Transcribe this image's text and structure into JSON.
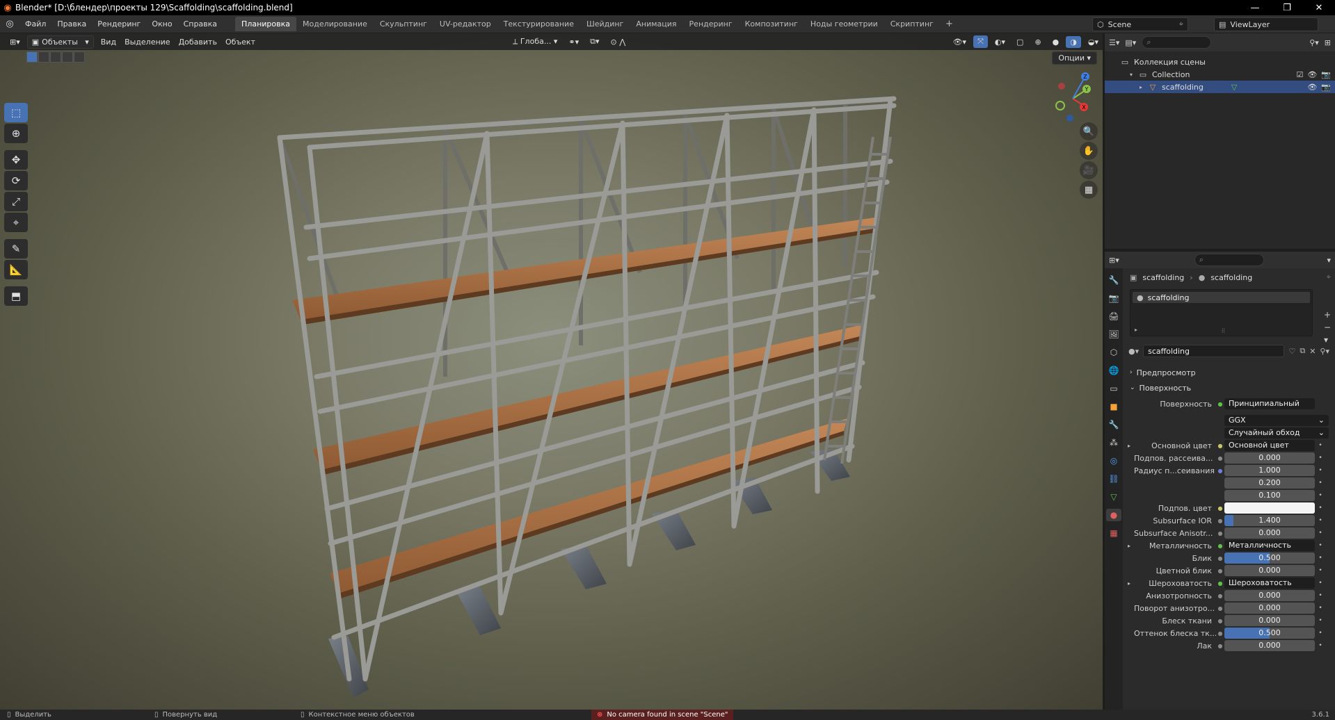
{
  "window": {
    "title": "Blender* [D:\\блендер\\проекты 129\\Scaffolding\\scaffolding.blend]",
    "controls": [
      "—",
      "❐",
      "✕"
    ]
  },
  "menu": [
    "Файл",
    "Правка",
    "Рендеринг",
    "Окно",
    "Справка"
  ],
  "workspaces": [
    "Планировка",
    "Моделирование",
    "Скульптинг",
    "UV-редактор",
    "Текстурирование",
    "Шейдинг",
    "Анимация",
    "Рендеринг",
    "Композитинг",
    "Ноды геометрии",
    "Скриптинг"
  ],
  "active_workspace": "Планировка",
  "scene": {
    "name": "Scene",
    "view_layer": "ViewLayer"
  },
  "viewport": {
    "mode": "Объекты",
    "menus": [
      "Вид",
      "Выделение",
      "Добавить",
      "Объект"
    ],
    "orientation": "Глоба...",
    "options_label": "Опции",
    "gizmo_axes": {
      "x": "X",
      "y": "Y",
      "z": "Z"
    }
  },
  "outliner": {
    "rows": [
      {
        "label": "Коллекция сцены",
        "icon": "scene-collection-icon"
      },
      {
        "label": "Collection",
        "icon": "collection-icon"
      },
      {
        "label": "scaffolding",
        "icon": "mesh-object-icon",
        "selected": true
      }
    ]
  },
  "properties": {
    "breadcrumb": [
      "scaffolding",
      "scaffolding"
    ],
    "material_slot": "scaffolding",
    "material_name": "scaffolding",
    "sections": {
      "preview": "Предпросмотр",
      "surface": "Поверхность"
    },
    "surface_label": "Поверхность",
    "surface_value": "Принципиальный BSDF",
    "distribution": "GGX",
    "subsurface_method": "Случайный обход",
    "rows": [
      {
        "label": "Основной цвет",
        "value": "Основной цвет",
        "kind": "link",
        "dot": "yellow",
        "expand": true
      },
      {
        "label": "Подпов. рассеива...",
        "value": "0.000",
        "kind": "num",
        "dot": "gray"
      },
      {
        "label": "Радиус п...сеивания",
        "value": "1.000",
        "kind": "num",
        "dot": "blue"
      },
      {
        "label": "",
        "value": "0.200",
        "kind": "num",
        "dot": ""
      },
      {
        "label": "",
        "value": "0.100",
        "kind": "num",
        "dot": ""
      },
      {
        "label": "Подпов. цвет",
        "value": "",
        "kind": "color",
        "dot": "yellow"
      },
      {
        "label": "Subsurface IOR",
        "value": "1.400",
        "kind": "num",
        "dot": "gray",
        "fill": 0.1
      },
      {
        "label": "Subsurface Anisotr...",
        "value": "0.000",
        "kind": "num",
        "dot": "gray"
      },
      {
        "label": "Металличность",
        "value": "Металличность",
        "kind": "link",
        "dot": "green",
        "expand": true
      },
      {
        "label": "Блик",
        "value": "0.500",
        "kind": "num",
        "dot": "gray",
        "fill": 0.5
      },
      {
        "label": "Цветной блик",
        "value": "0.000",
        "kind": "num",
        "dot": "gray"
      },
      {
        "label": "Шероховатость",
        "value": "Шероховатость",
        "kind": "link",
        "dot": "green",
        "expand": true
      },
      {
        "label": "Анизотропность",
        "value": "0.000",
        "kind": "num",
        "dot": "gray"
      },
      {
        "label": "Поворот анизотро...",
        "value": "0.000",
        "kind": "num",
        "dot": "gray"
      },
      {
        "label": "Блеск ткани",
        "value": "0.000",
        "kind": "num",
        "dot": "gray"
      },
      {
        "label": "Оттенок блеска тк...",
        "value": "0.500",
        "kind": "num",
        "dot": "gray",
        "fill": 0.5
      },
      {
        "label": "Лак",
        "value": "0.000",
        "kind": "num",
        "dot": "gray"
      }
    ]
  },
  "statusbar": {
    "select": "Выделить",
    "rotate": "Повернуть вид",
    "context": "Контекстное меню объектов",
    "warning": "No camera found in scene \"Scene\"",
    "version": "3.6.1"
  },
  "colors": {
    "accent": "#4772b3",
    "wood": "#b5774a",
    "metal": "#8c8c8c",
    "warning": "#ff5050"
  }
}
